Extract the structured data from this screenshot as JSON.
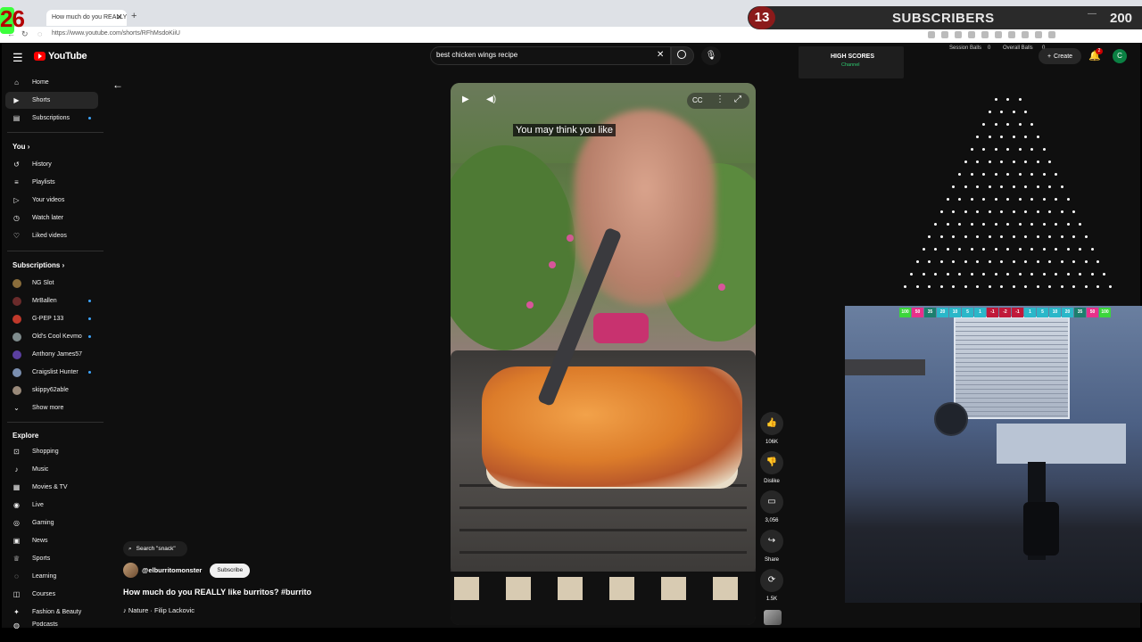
{
  "browser": {
    "tab_title": "How much do you REALLY like",
    "url": "https://www.youtube.com/shorts/RFhMsdoKiiU"
  },
  "overlay": {
    "score": "26",
    "sub_goal_number": "13",
    "subscribers_label": "SUBSCRIBERS",
    "subscribers_count": "200",
    "high_scores_title": "HIGH SCORES",
    "high_scores_sub": "Channel",
    "session_balls_label": "Session Balls",
    "session_balls_value": "0",
    "overall_balls_label": "Overall Balls",
    "overall_balls_value": "0",
    "slots": [
      {
        "label": "100",
        "color": "#3cd63c"
      },
      {
        "label": "50",
        "color": "#e8318a"
      },
      {
        "label": "35",
        "color": "#1d7f6e"
      },
      {
        "label": "20",
        "color": "#2ab7c9"
      },
      {
        "label": "10",
        "color": "#2ab7c9"
      },
      {
        "label": "5",
        "color": "#2ab7c9"
      },
      {
        "label": "1",
        "color": "#2ab7c9"
      },
      {
        "label": "-1",
        "color": "#c0193a"
      },
      {
        "label": "-2",
        "color": "#c0193a"
      },
      {
        "label": "-1",
        "color": "#c0193a"
      },
      {
        "label": "1",
        "color": "#2ab7c9"
      },
      {
        "label": "5",
        "color": "#2ab7c9"
      },
      {
        "label": "10",
        "color": "#2ab7c9"
      },
      {
        "label": "20",
        "color": "#2ab7c9"
      },
      {
        "label": "35",
        "color": "#1d7f6e"
      },
      {
        "label": "50",
        "color": "#e8318a"
      },
      {
        "label": "100",
        "color": "#3cd63c"
      }
    ]
  },
  "youtube": {
    "logo_text": "YouTube",
    "search_value": "best chicken wings recipe",
    "create_label": "Create",
    "notification_count": "2",
    "avatar_letter": "C",
    "sidebar": {
      "main": [
        {
          "label": "Home",
          "icon": "home-icon",
          "glyph": "⌂"
        },
        {
          "label": "Shorts",
          "icon": "shorts-icon",
          "glyph": "▶"
        },
        {
          "label": "Subscriptions",
          "icon": "subscriptions-icon",
          "glyph": "▤"
        }
      ],
      "you_heading": "You",
      "you": [
        {
          "label": "History",
          "icon": "history-icon",
          "glyph": "↺"
        },
        {
          "label": "Playlists",
          "icon": "playlists-icon",
          "glyph": "≡"
        },
        {
          "label": "Your videos",
          "icon": "your-videos-icon",
          "glyph": "▷"
        },
        {
          "label": "Watch later",
          "icon": "watch-later-icon",
          "glyph": "◷"
        },
        {
          "label": "Liked videos",
          "icon": "liked-videos-icon",
          "glyph": "♡"
        }
      ],
      "subscriptions_heading": "Subscriptions",
      "subscriptions": [
        {
          "label": "NG Slot",
          "color": "#8a6d3b"
        },
        {
          "label": "MrBallen",
          "color": "#6b2b2b"
        },
        {
          "label": "G-PEP 133",
          "color": "#c0392b"
        },
        {
          "label": "Old's Cool Kevmo",
          "color": "#7f8c8d"
        },
        {
          "label": "Anthony James57",
          "color": "#5b3fa0"
        },
        {
          "label": "Craigslist Hunter",
          "color": "#7b8fb0"
        },
        {
          "label": "skippy62able",
          "color": "#9a8a7a"
        }
      ],
      "show_more": "Show more",
      "explore_heading": "Explore",
      "explore": [
        {
          "label": "Shopping",
          "icon": "shopping-icon",
          "glyph": "⊡"
        },
        {
          "label": "Music",
          "icon": "music-icon",
          "glyph": "♪"
        },
        {
          "label": "Movies & TV",
          "icon": "movies-icon",
          "glyph": "▦"
        },
        {
          "label": "Live",
          "icon": "live-icon",
          "glyph": "◉"
        },
        {
          "label": "Gaming",
          "icon": "gaming-icon",
          "glyph": "◎"
        },
        {
          "label": "News",
          "icon": "news-icon",
          "glyph": "▣"
        },
        {
          "label": "Sports",
          "icon": "sports-icon",
          "glyph": "♕"
        },
        {
          "label": "Learning",
          "icon": "learning-icon",
          "glyph": "◌"
        },
        {
          "label": "Courses",
          "icon": "courses-icon",
          "glyph": "◫"
        },
        {
          "label": "Fashion & Beauty",
          "icon": "fashion-icon",
          "glyph": "✦"
        },
        {
          "label": "Podcasts",
          "icon": "podcasts-icon",
          "glyph": "◍"
        }
      ]
    },
    "short": {
      "caption": "You may think you like",
      "search_pill": "Search \"snack\"",
      "channel": "@elburritomonster",
      "subscribe": "Subscribe",
      "title": "How much do you REALLY like burritos? #burrito",
      "music": "♪ Nature · Filip Lackovic",
      "likes": "106K",
      "dislike": "Dislike",
      "comments": "3,056",
      "share": "Share",
      "remix": "1.5K"
    }
  }
}
